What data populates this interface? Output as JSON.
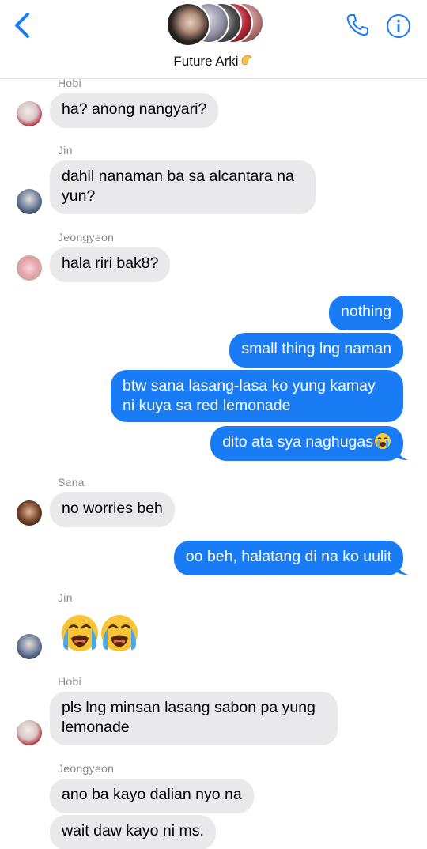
{
  "header": {
    "title": "Future Arki",
    "title_emoji": "pinching-hand-emoji"
  },
  "icons": {
    "back": "chevron-left-icon",
    "call": "phone-icon",
    "info": "info-icon"
  },
  "colors": {
    "accent": "#1a7cf5",
    "incoming_bubble": "#e9e9eb",
    "sender_label": "#8a8a8e"
  },
  "messages": [
    {
      "sender": "Hobi",
      "text": "ha? anong nangyari?"
    },
    {
      "sender": "Jin",
      "text": "dahil nanaman ba sa alcantara na yun?"
    },
    {
      "sender": "Jeongyeon",
      "text": "hala riri bak8?"
    },
    {
      "sender": "me",
      "text": "nothing"
    },
    {
      "sender": "me",
      "text": "small thing lng naman"
    },
    {
      "sender": "me",
      "text": "btw sana lasang-lasa ko yung kamay ni kuya sa red lemonade"
    },
    {
      "sender": "me",
      "text": "dito ata sya naghugas😭"
    },
    {
      "sender": "Sana",
      "text": "no worries beh"
    },
    {
      "sender": "me",
      "text": "oo beh, halatang di na ko uulit"
    },
    {
      "sender": "Jin",
      "text": "loudly-crying-face-emoji loudly-crying-face-emoji"
    },
    {
      "sender": "Hobi",
      "text": "pls lng minsan lasang sabon pa yung lemonade"
    },
    {
      "sender": "Jeongyeon",
      "text": "ano ba kayo dalian nyo na"
    },
    {
      "sender": "Jeongyeon",
      "text": "wait daw kayo ni ms."
    }
  ],
  "labels": {
    "hobi_1": "Hobi",
    "jin_1": "Jin",
    "jeongyeon_1": "Jeongyeon",
    "sana_1": "Sana",
    "jin_2": "Jin",
    "hobi_2": "Hobi",
    "jeongyeon_2": "Jeongyeon"
  },
  "texts": {
    "m1": "ha? anong nangyari?",
    "m2a": "dahil nanaman ba sa alcantara na",
    "m2b": "yun?",
    "m3": "hala riri bak8?",
    "m4": "nothing",
    "m5": "small thing lng naman",
    "m6a": "btw sana lasang-lasa ko yung kamay",
    "m6b": "ni kuya sa red lemonade",
    "m7": "dito ata sya naghugas",
    "m8": "no worries beh",
    "m9": "oo beh, halatang di na ko uulit",
    "m11a": "pls lng minsan lasang sabon pa yung",
    "m11b": "lemonade",
    "m12": "ano ba kayo dalian nyo na",
    "m13": "wait daw kayo ni ms."
  }
}
